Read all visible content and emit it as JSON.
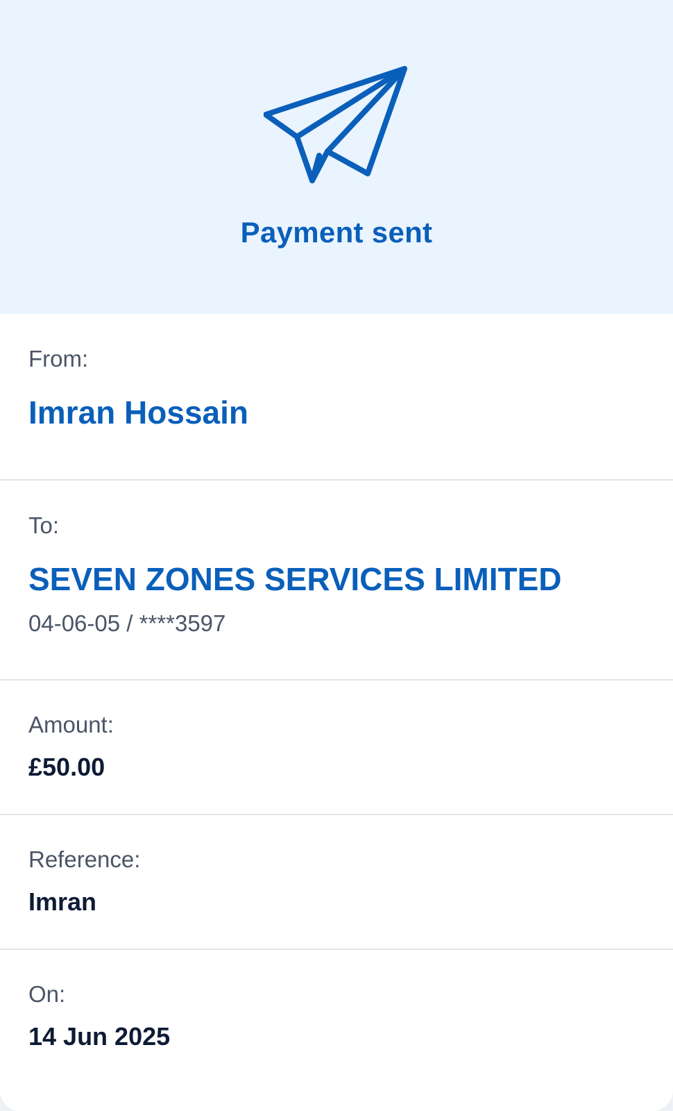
{
  "header": {
    "icon": "paper-plane-icon",
    "title": "Payment sent",
    "accent_color": "#0a5fba",
    "background_color": "#eaf4fe"
  },
  "from": {
    "label": "From:",
    "name": "Imran Hossain"
  },
  "to": {
    "label": "To:",
    "name": "SEVEN ZONES SERVICES LIMITED",
    "account": "04-06-05 / ****3597"
  },
  "amount": {
    "label": "Amount:",
    "value": "£50.00"
  },
  "reference": {
    "label": "Reference:",
    "value": "Imran"
  },
  "date": {
    "label": "On:",
    "value": "14 Jun 2025"
  }
}
